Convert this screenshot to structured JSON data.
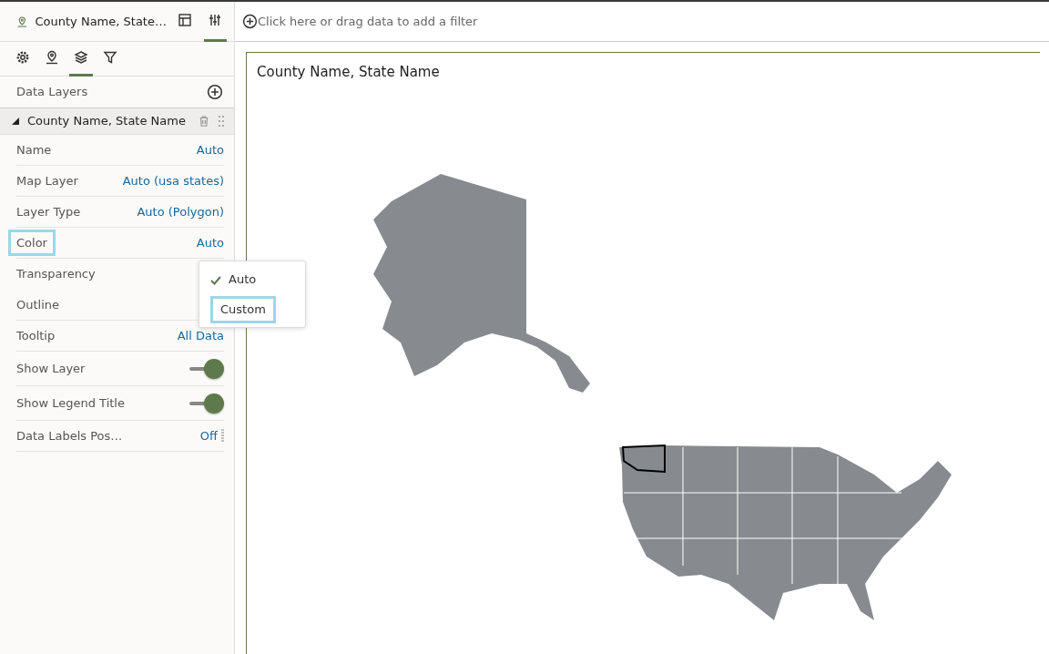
{
  "panel_header": {
    "title": "County Name, State…",
    "tabs": [
      {
        "selected": false
      },
      {
        "selected": true
      }
    ]
  },
  "section_tabs": [
    {
      "selected": false
    },
    {
      "selected": false
    },
    {
      "selected": true
    },
    {
      "selected": false
    }
  ],
  "data_layers": {
    "title": "Data Layers",
    "layer": {
      "name": "County Name, State Name",
      "expanded": true
    }
  },
  "properties": [
    {
      "kind": "value",
      "label": "Name",
      "value": "Auto",
      "highlighted": false
    },
    {
      "kind": "value",
      "label": "Map Layer",
      "value": "Auto (usa states)",
      "highlighted": false
    },
    {
      "kind": "value",
      "label": "Layer Type",
      "value": "Auto (Polygon)",
      "highlighted": false
    },
    {
      "kind": "value",
      "label": "Color",
      "value": "Auto",
      "highlighted": true
    },
    {
      "kind": "plain",
      "label": "Transparency",
      "highlighted": false
    },
    {
      "kind": "plain",
      "label": "Outline",
      "highlighted": false
    },
    {
      "kind": "value",
      "label": "Tooltip",
      "value": "All Data",
      "highlighted": false
    },
    {
      "kind": "toggle",
      "label": "Show Layer",
      "on": true,
      "highlighted": false
    },
    {
      "kind": "toggle",
      "label": "Show Legend Title",
      "on": true,
      "highlighted": false
    },
    {
      "kind": "value",
      "label": "Data Labels Pos…",
      "value": "Off",
      "highlighted": false
    }
  ],
  "color_menu": [
    {
      "label": "Auto",
      "checked": true,
      "highlighted": false
    },
    {
      "label": "Custom",
      "checked": false,
      "highlighted": true
    }
  ],
  "filter_bar": {
    "placeholder": "Click here or drag data to add a filter"
  },
  "map": {
    "title": "County Name, State Name"
  }
}
